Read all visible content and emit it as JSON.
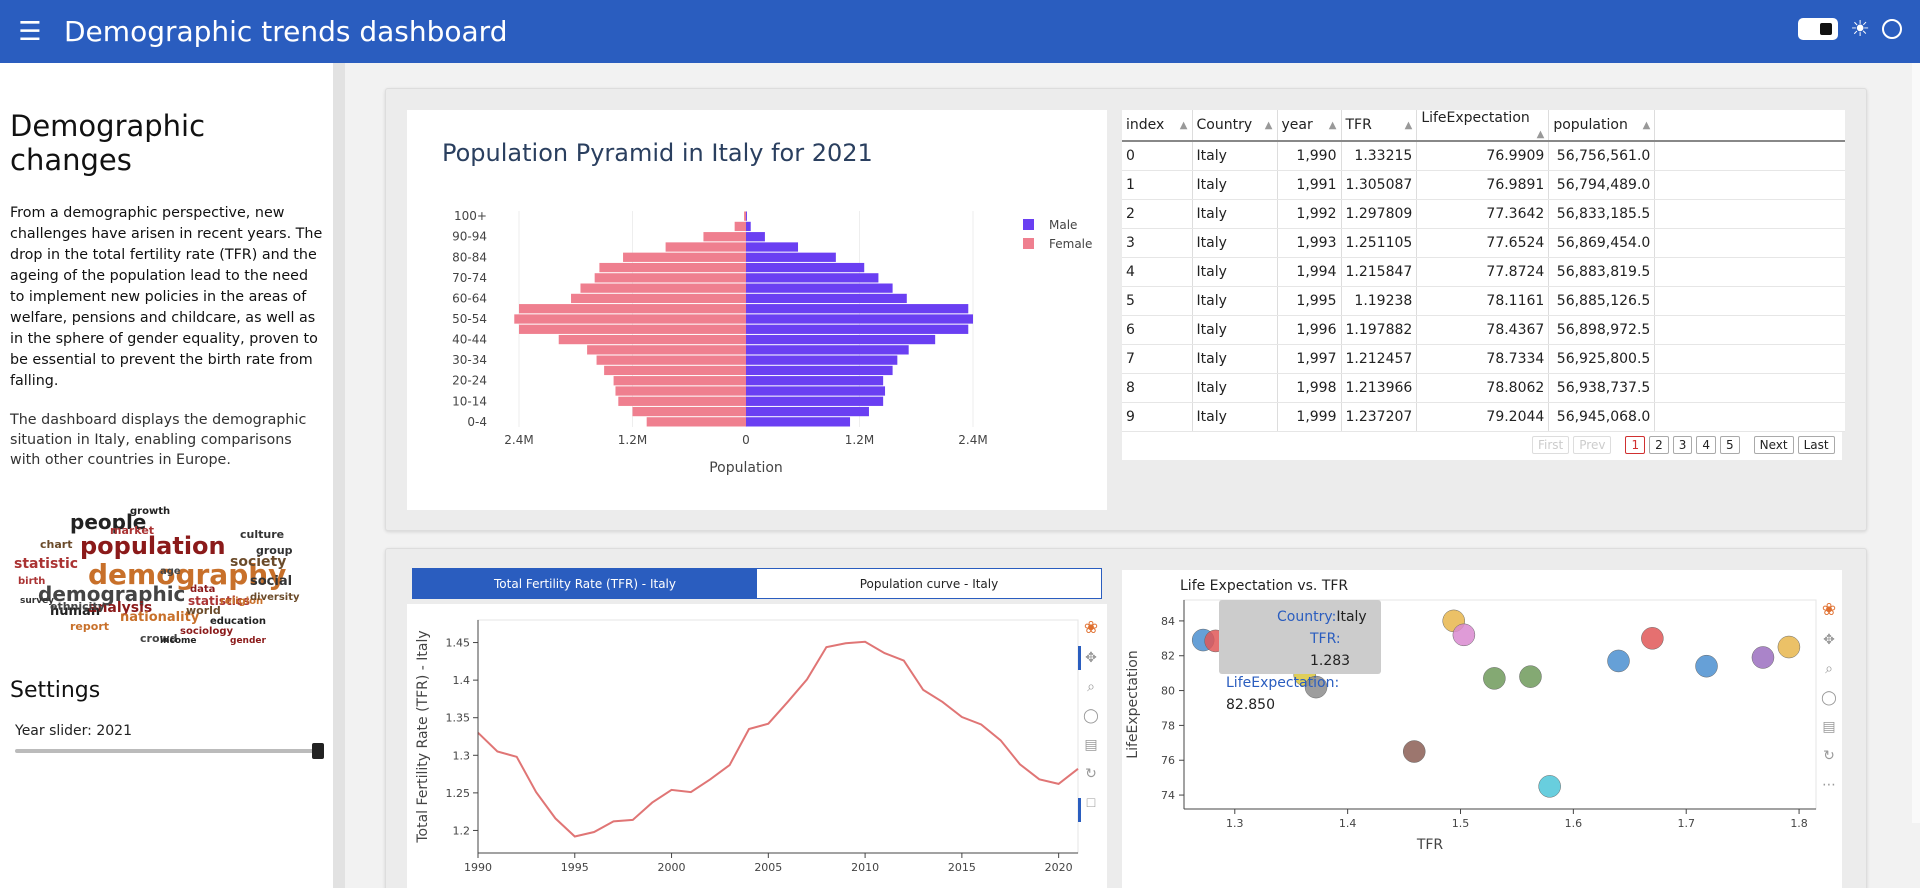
{
  "header": {
    "title": "Demographic trends dashboard",
    "menu_icon": "hamburger-icon",
    "theme_icon": "sun-icon"
  },
  "sidebar": {
    "heading": "Demographic changes",
    "intro": "From a demographic perspective, new challenges have arisen in recent years. The drop in the total fertility rate (TFR) and the ageing of the population lead to the need to implement new policies in the areas of welfare, pensions and childcare, as well as in the sphere of gender equality, proven to be essential to prevent the birth rate from falling.",
    "description": "The dashboard displays the demographic situation in Italy, enabling comparisons with other countries in Europe.",
    "wordcloud": [
      "people",
      "population",
      "demography",
      "demographic",
      "statistic",
      "society",
      "social",
      "human",
      "analysis",
      "nationality",
      "ethnicity",
      "statistics",
      "world",
      "group",
      "growth",
      "data",
      "report",
      "crowd",
      "market",
      "chart",
      "culture",
      "education",
      "sociology",
      "religion",
      "age",
      "birth",
      "diversity",
      "survey",
      "income",
      "gender"
    ],
    "settings_heading": "Settings",
    "slider_label": "Year slider:",
    "slider_value": "2021",
    "slider_fraction": 1.0
  },
  "pyramid": {
    "title": "Population Pyramid in Italy for 2021",
    "xlabel": "Population",
    "legend": [
      "Male",
      "Female"
    ],
    "x_ticks": [
      "2.4M",
      "1.2M",
      "0",
      "1.2M",
      "2.4M"
    ],
    "y_ticks": [
      "100+",
      "90-94",
      "80-84",
      "70-74",
      "60-64",
      "50-54",
      "40-44",
      "30-34",
      "20-24",
      "10-14",
      "0-4"
    ]
  },
  "table": {
    "columns": [
      "index",
      "Country",
      "year",
      "TFR",
      "LifeExpectation",
      "population"
    ],
    "rows": [
      [
        "0",
        "Italy",
        "1,990",
        "1.33215",
        "76.9909",
        "56,756,561.0"
      ],
      [
        "1",
        "Italy",
        "1,991",
        "1.305087",
        "76.9891",
        "56,794,489.0"
      ],
      [
        "2",
        "Italy",
        "1,992",
        "1.297809",
        "77.3642",
        "56,833,185.5"
      ],
      [
        "3",
        "Italy",
        "1,993",
        "1.251105",
        "77.6524",
        "56,869,454.0"
      ],
      [
        "4",
        "Italy",
        "1,994",
        "1.215847",
        "77.8724",
        "56,883,819.5"
      ],
      [
        "5",
        "Italy",
        "1,995",
        "1.19238",
        "78.1161",
        "56,885,126.5"
      ],
      [
        "6",
        "Italy",
        "1,996",
        "1.197882",
        "78.4367",
        "56,898,972.5"
      ],
      [
        "7",
        "Italy",
        "1,997",
        "1.212457",
        "78.7334",
        "56,925,800.5"
      ],
      [
        "8",
        "Italy",
        "1,998",
        "1.213966",
        "78.8062",
        "56,938,737.5"
      ],
      [
        "9",
        "Italy",
        "1,999",
        "1.237207",
        "79.2044",
        "56,945,068.0"
      ]
    ],
    "pager": {
      "first": "First",
      "prev": "Prev",
      "pages": [
        "1",
        "2",
        "3",
        "4",
        "5"
      ],
      "next": "Next",
      "last": "Last"
    }
  },
  "tabs": [
    "Total Fertility Rate (TFR) - Italy",
    "Population curve - Italy"
  ],
  "tooltip": {
    "country_key": "Country:",
    "country_val": "Italy",
    "tfr_key": "TFR:",
    "tfr_val": "1.283",
    "le_key": "LifeExpectation:",
    "le_val": "82.850"
  },
  "colors": {
    "accent": "#2a5dbf",
    "male": "#6a3ff2",
    "female": "#ef7f8f",
    "line": "#e07575"
  },
  "chart_data": [
    {
      "type": "bar",
      "title": "Population Pyramid in Italy for 2021",
      "xlabel": "Population",
      "categories": [
        "0-4",
        "5-9",
        "10-14",
        "15-19",
        "20-24",
        "25-29",
        "30-34",
        "35-39",
        "40-44",
        "45-49",
        "50-54",
        "55-59",
        "60-64",
        "65-69",
        "70-74",
        "75-79",
        "80-84",
        "85-89",
        "90-94",
        "95-99",
        "100+"
      ],
      "series": [
        {
          "name": "Male",
          "values": [
            1.1,
            1.3,
            1.45,
            1.47,
            1.45,
            1.55,
            1.6,
            1.72,
            2.0,
            2.35,
            2.4,
            2.35,
            1.7,
            1.55,
            1.4,
            1.25,
            0.95,
            0.55,
            0.2,
            0.05,
            0.01
          ]
        },
        {
          "name": "Female",
          "values": [
            1.05,
            1.2,
            1.35,
            1.38,
            1.4,
            1.5,
            1.58,
            1.68,
            1.98,
            2.4,
            2.45,
            2.4,
            1.85,
            1.75,
            1.6,
            1.55,
            1.3,
            0.85,
            0.45,
            0.12,
            0.02
          ]
        }
      ],
      "unit": "millions",
      "xlim": [
        -2.4,
        2.4
      ]
    },
    {
      "type": "line",
      "ylabel": "Total Fertility Rate (TFR) - Italy",
      "x": [
        1990,
        1991,
        1992,
        1993,
        1994,
        1995,
        1996,
        1997,
        1998,
        1999,
        2000,
        2001,
        2002,
        2003,
        2004,
        2005,
        2006,
        2007,
        2008,
        2009,
        2010,
        2011,
        2012,
        2013,
        2014,
        2015,
        2016,
        2017,
        2018,
        2019,
        2020,
        2021
      ],
      "y": [
        1.33,
        1.305,
        1.298,
        1.251,
        1.216,
        1.192,
        1.198,
        1.212,
        1.214,
        1.237,
        1.254,
        1.251,
        1.268,
        1.287,
        1.335,
        1.342,
        1.371,
        1.401,
        1.444,
        1.449,
        1.451,
        1.436,
        1.426,
        1.387,
        1.371,
        1.351,
        1.341,
        1.32,
        1.288,
        1.268,
        1.262,
        1.282
      ],
      "x_ticks": [
        "1990",
        "1995",
        "2000",
        "2005",
        "2010",
        "2015",
        "2020"
      ],
      "y_ticks": [
        "1.2",
        "1.25",
        "1.3",
        "1.35",
        "1.4",
        "1.45"
      ],
      "xlim": [
        1990,
        2021
      ],
      "ylim": [
        1.17,
        1.48
      ]
    },
    {
      "type": "scatter",
      "title": "Life Expectation vs. TFR",
      "xlabel": "TFR",
      "ylabel": "LifeExpectation",
      "x_ticks": [
        "1.3",
        "1.4",
        "1.5",
        "1.6",
        "1.7",
        "1.8"
      ],
      "y_ticks": [
        "74",
        "76",
        "78",
        "80",
        "82",
        "84"
      ],
      "xlim": [
        1.255,
        1.815
      ],
      "ylim": [
        73.2,
        85.2
      ],
      "points": [
        {
          "x": 1.272,
          "y": 82.9,
          "color": "#4b8fd0"
        },
        {
          "x": 1.283,
          "y": 82.85,
          "color": "#e05757"
        },
        {
          "x": 1.362,
          "y": 80.9,
          "color": "#d9c53c"
        },
        {
          "x": 1.372,
          "y": 80.2,
          "color": "#8c8c8c"
        },
        {
          "x": 1.459,
          "y": 76.5,
          "color": "#8b5e55"
        },
        {
          "x": 1.494,
          "y": 84.0,
          "color": "#e8b64c"
        },
        {
          "x": 1.503,
          "y": 83.2,
          "color": "#d98ad0"
        },
        {
          "x": 1.53,
          "y": 80.7,
          "color": "#6e9a5b"
        },
        {
          "x": 1.562,
          "y": 80.8,
          "color": "#6e9a5b"
        },
        {
          "x": 1.579,
          "y": 74.5,
          "color": "#4ec5d8"
        },
        {
          "x": 1.64,
          "y": 81.7,
          "color": "#4b8fd0"
        },
        {
          "x": 1.67,
          "y": 83.0,
          "color": "#e05757"
        },
        {
          "x": 1.718,
          "y": 81.4,
          "color": "#4b8fd0"
        },
        {
          "x": 1.768,
          "y": 81.9,
          "color": "#9b6fc0"
        },
        {
          "x": 1.791,
          "y": 82.5,
          "color": "#e8b64c"
        }
      ]
    }
  ]
}
